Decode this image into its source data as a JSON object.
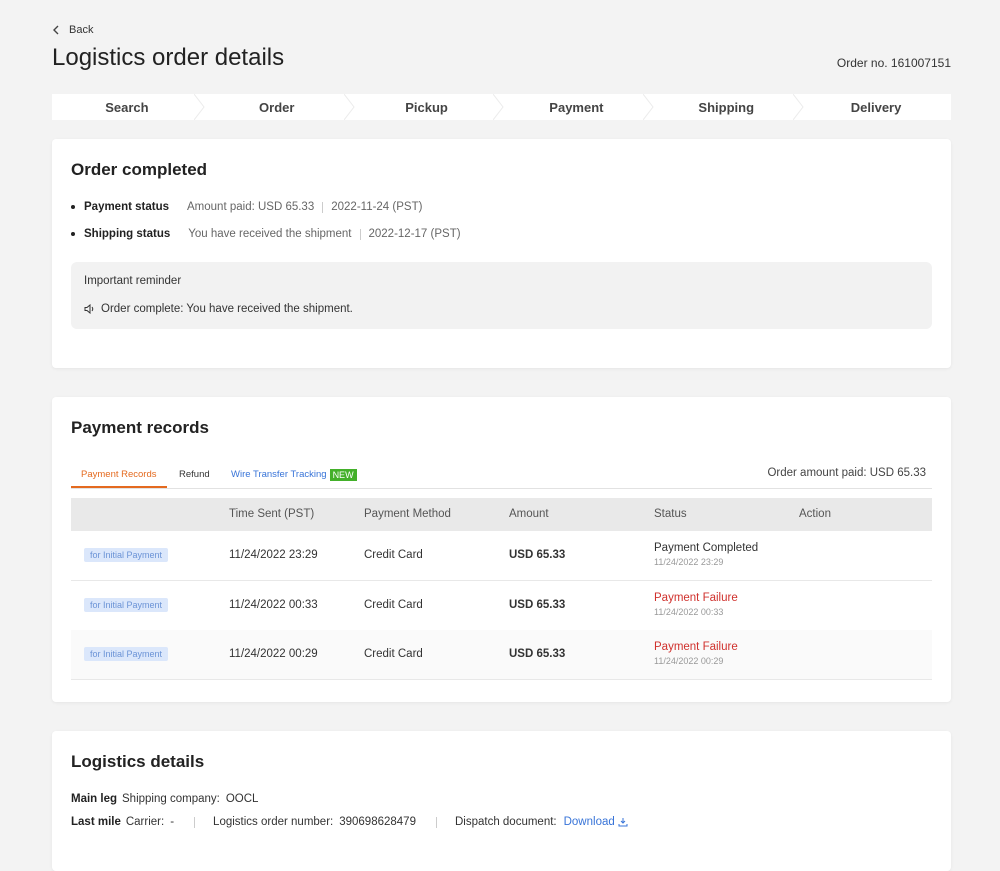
{
  "header": {
    "back_label": "Back",
    "title": "Logistics order details",
    "order_no": "Order no. 161007151"
  },
  "steps": [
    "Search",
    "Order",
    "Pickup",
    "Payment",
    "Shipping",
    "Delivery"
  ],
  "order_card": {
    "title": "Order completed",
    "payment_status": {
      "label": "Payment status",
      "value": "Amount paid: USD 65.33",
      "date": "2022-11-24 (PST)"
    },
    "shipping_status": {
      "label": "Shipping status",
      "value": "You have received the shipment",
      "date": "2022-12-17 (PST)"
    },
    "reminder": {
      "title": "Important reminder",
      "message": "Order complete: You have received the shipment."
    }
  },
  "payment_card": {
    "title": "Payment records",
    "tabs": [
      "Payment Records",
      "Refund",
      "Wire Transfer Tracking"
    ],
    "new_badge": "NEW",
    "order_amount_paid": "Order amount paid: USD 65.33",
    "columns": [
      "Time Sent (PST)",
      "Payment Method",
      "Amount",
      "Status",
      "Action"
    ],
    "rows": [
      {
        "tag": "for Initial Payment",
        "time": "11/24/2022 23:29",
        "method": "Credit Card",
        "amount": "USD 65.33",
        "status": "Payment Completed",
        "status_time": "11/24/2022 23:29"
      },
      {
        "tag": "for Initial Payment",
        "time": "11/24/2022 00:33",
        "method": "Credit Card",
        "amount": "USD 65.33",
        "status": "Payment Failure",
        "status_time": "11/24/2022 00:33"
      },
      {
        "tag": "for Initial Payment",
        "time": "11/24/2022 00:29",
        "method": "Credit Card",
        "amount": "USD 65.33",
        "status": "Payment Failure",
        "status_time": "11/24/2022 00:29"
      }
    ]
  },
  "logistics_card": {
    "title": "Logistics details",
    "main_leg": {
      "label": "Main leg",
      "company_label": "Shipping company:",
      "company": "OOCL"
    },
    "last_mile": {
      "label": "Last mile",
      "carrier_label": "Carrier:",
      "carrier": "-",
      "order_number_label": "Logistics order number:",
      "order_number": "390698628479",
      "dispatch_label": "Dispatch document:",
      "download_label": "Download"
    }
  },
  "colors": {
    "accent": "#e46a1f",
    "link": "#3874d8",
    "failure": "#d0312d",
    "new_badge": "#43b02a",
    "tag_bg": "#dbe7fb"
  }
}
